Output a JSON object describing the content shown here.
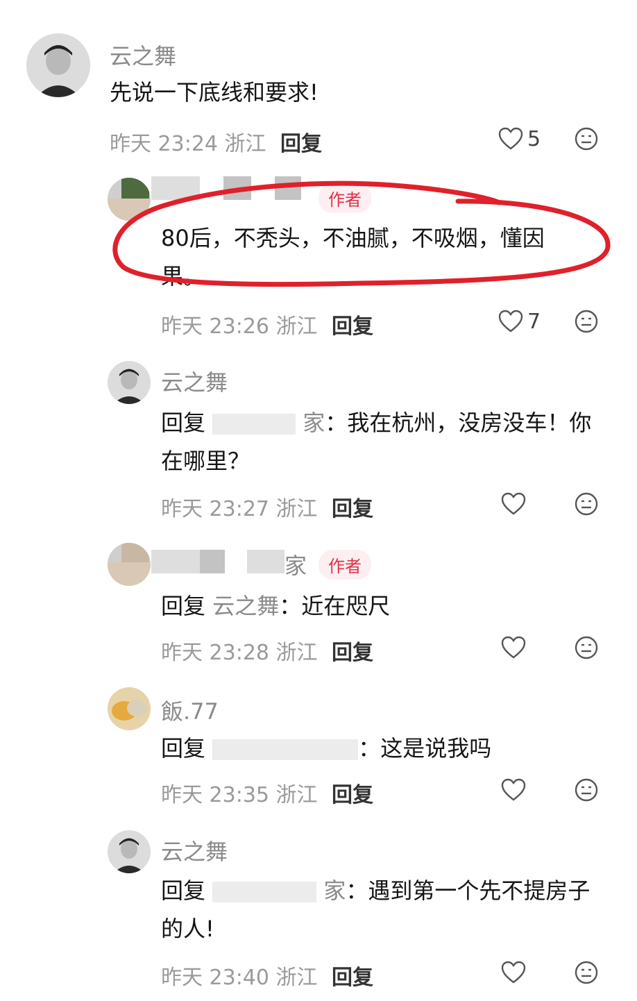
{
  "comments": [
    {
      "username": "云之舞",
      "text": "先说一下底线和要求!",
      "time": "昨天 23:24",
      "location": "浙江",
      "reply_label": "回复",
      "likes": "5"
    },
    {
      "username": "",
      "author_tag": "作者",
      "text": "80后，不秃头，不油腻，不吸烟，懂因果。",
      "time": "昨天 23:26",
      "location": "浙江",
      "reply_label": "回复",
      "likes": "7"
    },
    {
      "username": "云之舞",
      "reply_prefix": "回复",
      "reply_target": "家",
      "text": "我在杭州，没房没车！你在哪里？",
      "time": "昨天 23:27",
      "location": "浙江",
      "reply_label": "回复"
    },
    {
      "username": "家",
      "author_tag": "作者",
      "reply_prefix": "回复",
      "reply_target": "云之舞",
      "text": "近在咫尺",
      "time": "昨天 23:28",
      "location": "浙江",
      "reply_label": "回复"
    },
    {
      "username": "飯.77",
      "reply_prefix": "回复",
      "reply_target": "",
      "text": "这是说我吗",
      "time": "昨天 23:35",
      "location": "浙江",
      "reply_label": "回复"
    },
    {
      "username": "云之舞",
      "reply_prefix": "回复",
      "reply_target": "家",
      "text": "遇到第一个先不提房子的人!",
      "time": "昨天 23:40",
      "location": "浙江",
      "reply_label": "回复"
    }
  ],
  "colors": {
    "author_tag_bg": "#fdeff1",
    "author_tag_text": "#e0304a",
    "annotation_circle": "#e0202a"
  },
  "icons": {
    "like": "heart-outline-icon",
    "dislike": "neutral-face-icon"
  }
}
